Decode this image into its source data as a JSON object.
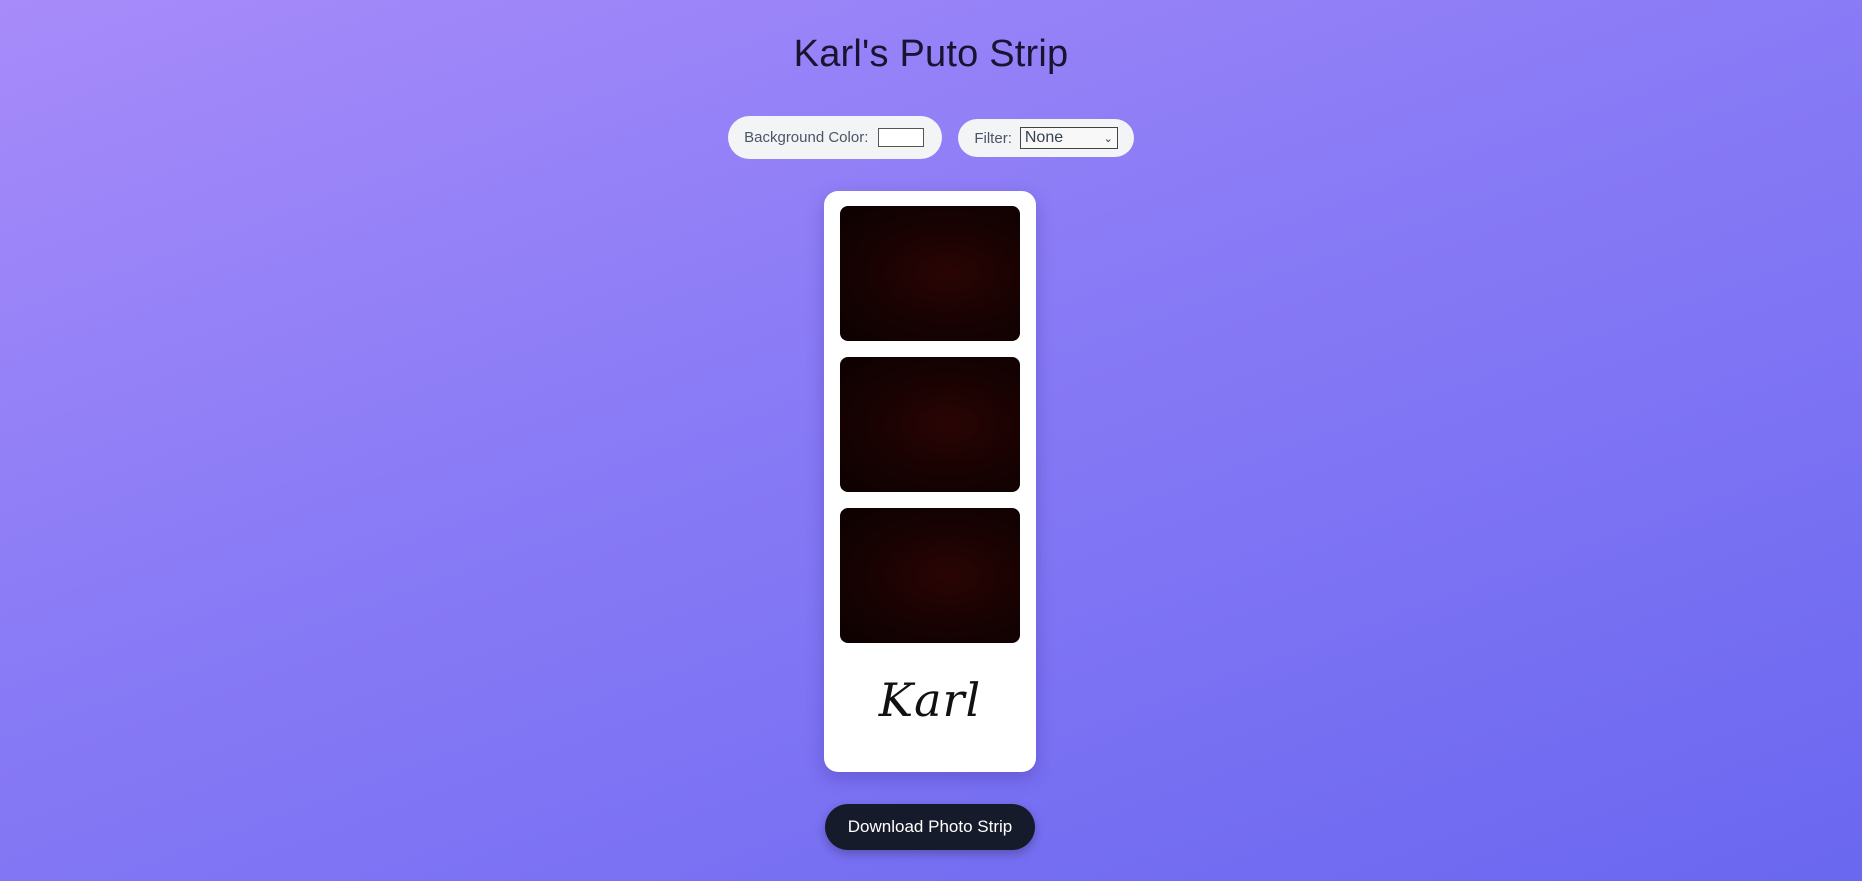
{
  "page": {
    "title": "Karl's Puto Strip"
  },
  "controls": {
    "background_color_label": "Background Color:",
    "background_color_value": "#ffffff",
    "filter_label": "Filter:",
    "filter_selected": "None"
  },
  "strip": {
    "background": "#ffffff",
    "photo_count": 3,
    "signature": "Karl"
  },
  "actions": {
    "download_label": "Download Photo Strip"
  },
  "colors": {
    "gradient_start": "#a78bfa",
    "gradient_end": "#6a67f0",
    "button_bg": "#161b2b",
    "photo_dark": "#170202"
  }
}
